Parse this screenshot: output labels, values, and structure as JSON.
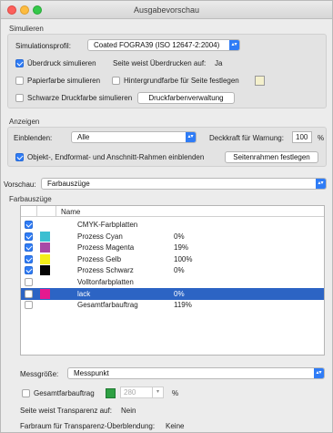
{
  "window": {
    "title": "Ausgabevorschau"
  },
  "simulieren": {
    "section_label": "Simulieren",
    "profile_label": "Simulationsprofil:",
    "profile_value": "Coated FOGRA39 (ISO 12647-2:2004)",
    "overprint_label": "Überdruck simulieren",
    "overprint_checked": true,
    "page_overprint_label": "Seite weist Überdrucken auf:",
    "page_overprint_value": "Ja",
    "paper_color_label": "Papierfarbe simulieren",
    "paper_color_checked": false,
    "bg_color_label": "Hintergrundfarbe für Seite festlegen",
    "bg_color_checked": false,
    "black_ink_label": "Schwarze Druckfarbe simulieren",
    "black_ink_checked": false,
    "ink_manager_button": "Druckfarbenverwaltung",
    "bg_swatch_color": "#f4f0cc"
  },
  "anzeigen": {
    "section_label": "Anzeigen",
    "show_label": "Einblenden:",
    "show_value": "Alle",
    "opacity_label": "Deckkraft für Warnung:",
    "opacity_value": "100",
    "opacity_unit": "%",
    "frames_label": "Objekt-, Endformat- und Anschnitt-Rahmen einblenden",
    "frames_checked": true,
    "page_frames_button": "Seitenrahmen festlegen"
  },
  "vorschau": {
    "label": "Vorschau:",
    "value": "Farbauszüge"
  },
  "farbauszuege": {
    "section_label": "Farbauszüge",
    "col_name": "Name",
    "rows": [
      {
        "name": "CMYK-Farbplatten",
        "pct": "",
        "checked": true,
        "swatch": ""
      },
      {
        "name": "Prozess Cyan",
        "pct": "0%",
        "checked": true,
        "swatch": "#3bbfd1"
      },
      {
        "name": "Prozess Magenta",
        "pct": "19%",
        "checked": true,
        "swatch": "#a849a6"
      },
      {
        "name": "Prozess Gelb",
        "pct": "100%",
        "checked": true,
        "swatch": "#f4ef1a"
      },
      {
        "name": "Prozess Schwarz",
        "pct": "0%",
        "checked": true,
        "swatch": "#050505"
      },
      {
        "name": "Volltonfarbplatten",
        "pct": "",
        "checked": false,
        "swatch": ""
      },
      {
        "name": "lack",
        "pct": "0%",
        "checked": false,
        "swatch": "#e6198f",
        "selected": true
      },
      {
        "name": "Gesamtfarbauftrag",
        "pct": "119%",
        "checked": false,
        "swatch": ""
      }
    ]
  },
  "bottom": {
    "sample_size_label": "Messgröße:",
    "sample_size_value": "Messpunkt",
    "total_ink_label": "Gesamtfarbauftrag",
    "total_ink_checked": false,
    "total_ink_value": "280",
    "total_ink_unit": "%",
    "total_ink_swatch": "#2ea043",
    "transparency_label": "Seite weist Transparenz auf:",
    "transparency_value": "Nein",
    "blend_space_label": "Farbraum für Transparenz-Überblendung:",
    "blend_space_value": "Keine"
  },
  "colors": {
    "accent": "#2f7cf6",
    "selection": "#2c64c4"
  }
}
